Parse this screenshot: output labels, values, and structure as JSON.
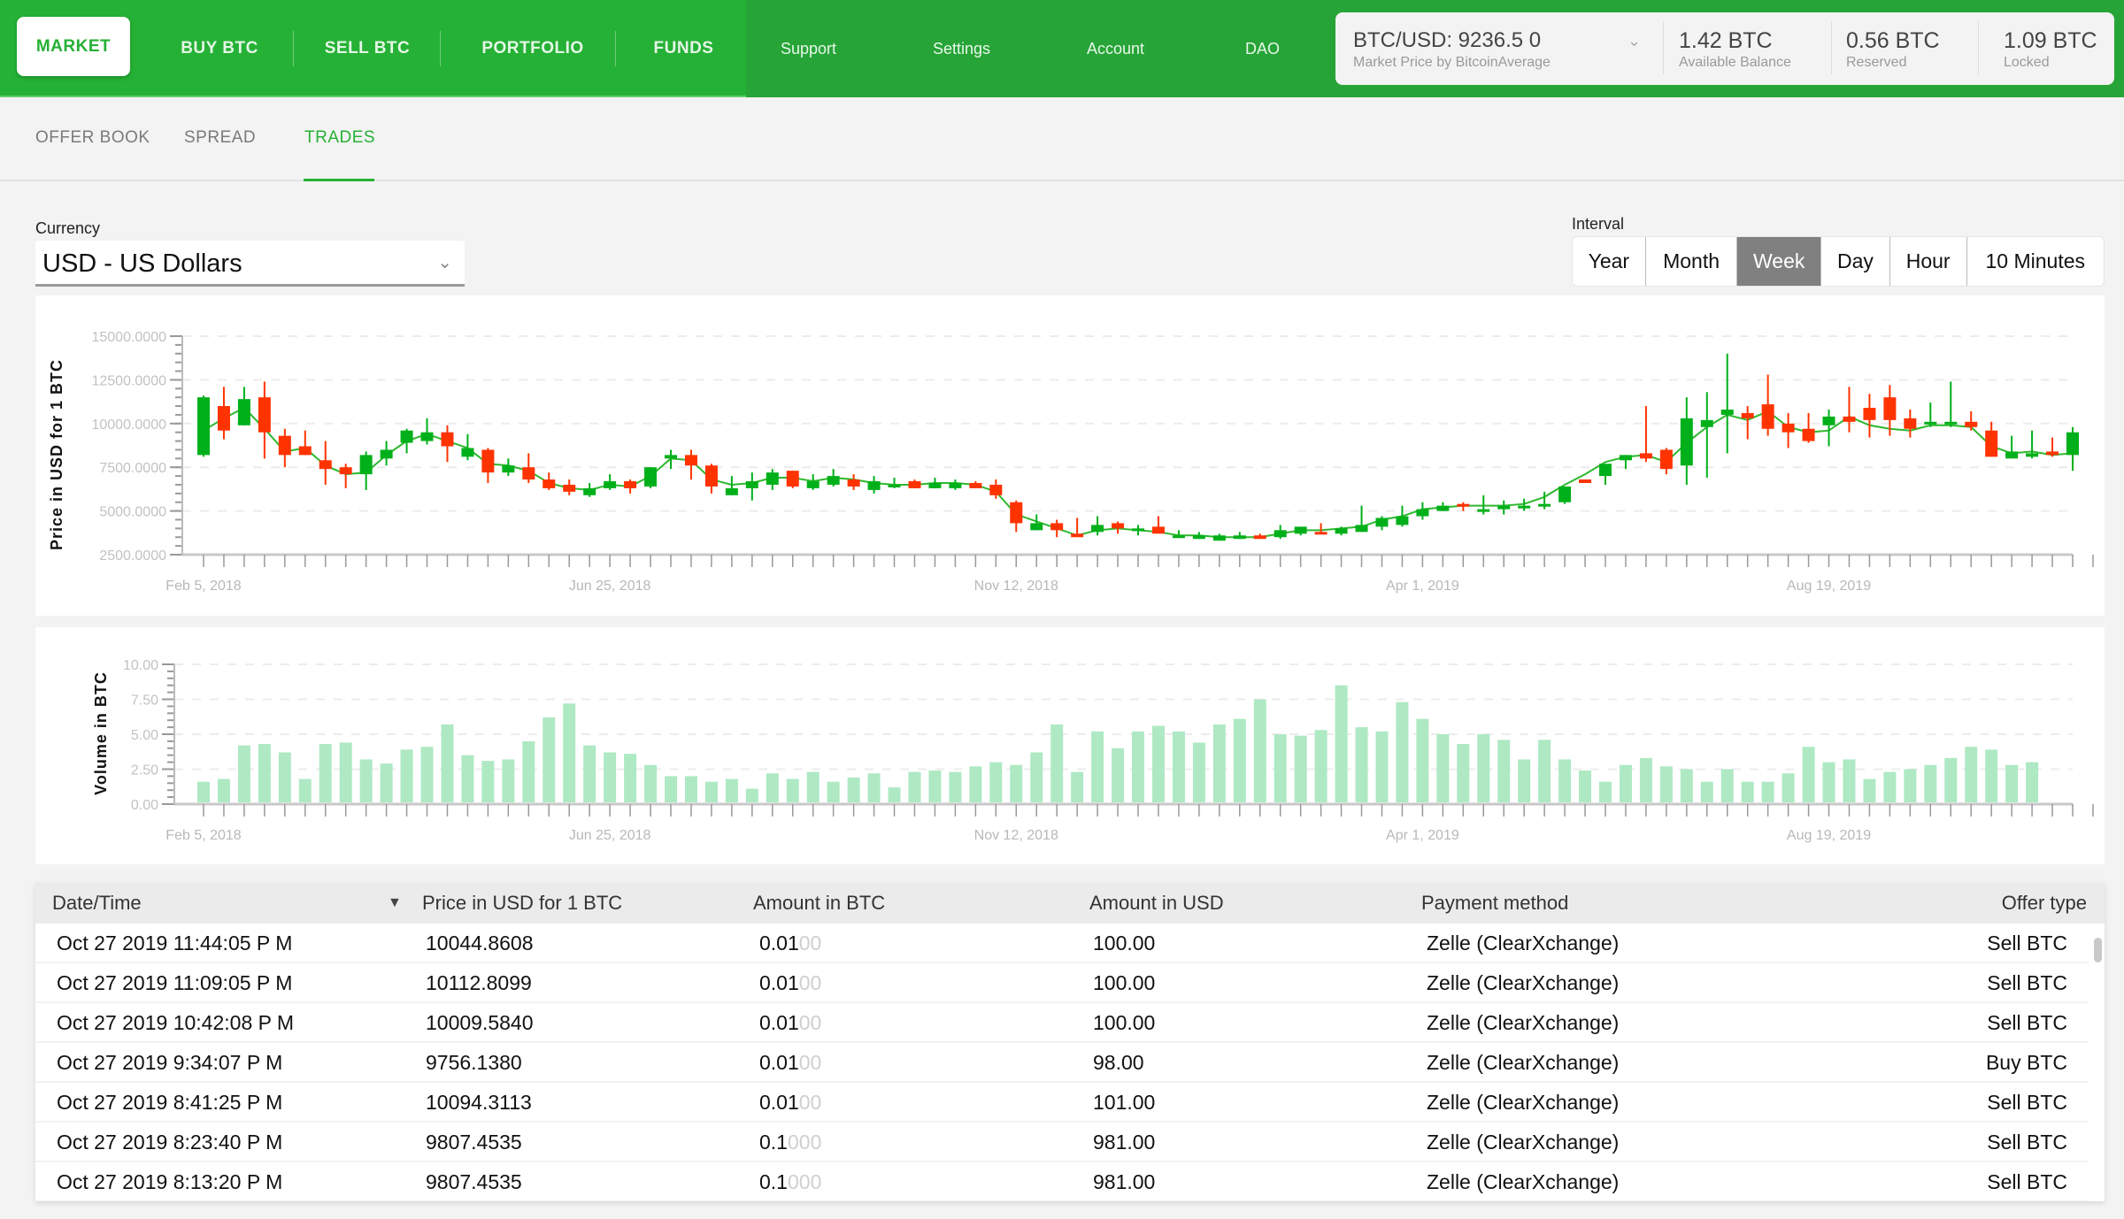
{
  "nav": {
    "primary": [
      {
        "label": "MARKET",
        "active": true
      },
      {
        "label": "BUY BTC",
        "active": false
      },
      {
        "label": "SELL BTC",
        "active": false
      },
      {
        "label": "PORTFOLIO",
        "active": false
      },
      {
        "label": "FUNDS",
        "active": false
      }
    ],
    "secondary": [
      "Support",
      "Settings",
      "Account",
      "DAO"
    ]
  },
  "ticker": {
    "price": "BTC/USD: 9236.5 0",
    "source": "Market Price by BitcoinAverage",
    "balances": [
      {
        "value": "1.42 BTC",
        "label": "Available Balance"
      },
      {
        "value": "0.56 BTC",
        "label": "Reserved"
      },
      {
        "value": "1.09 BTC",
        "label": "Locked"
      }
    ]
  },
  "subtabs": [
    {
      "label": "OFFER BOOK",
      "active": false
    },
    {
      "label": "SPREAD",
      "active": false
    },
    {
      "label": "TRADES",
      "active": true
    }
  ],
  "currency": {
    "label": "Currency",
    "value": "USD - US Dollars"
  },
  "interval": {
    "label": "Interval",
    "options": [
      "Year",
      "Month",
      "Week",
      "Day",
      "Hour",
      "10 Minutes"
    ],
    "selected": "Week"
  },
  "colors": {
    "brand": "#25b135",
    "up": "#00b01a",
    "down": "#ff3300",
    "volume": "#aee9c4",
    "ma_line": "#2eb82e"
  },
  "chart_data": [
    {
      "type": "candlestick",
      "title": "",
      "ylabel": "Price in USD for 1 BTC",
      "xlabel": "",
      "ylim": [
        2500,
        15000
      ],
      "y_ticks": [
        "15000.0000",
        "12500.0000",
        "10000.0000",
        "7500.0000",
        "5000.0000",
        "2500.0000"
      ],
      "x_tick_labels": [
        {
          "label": "Feb 5, 2018",
          "index": 0
        },
        {
          "label": "Jun 25, 2018",
          "index": 20
        },
        {
          "label": "Nov 12, 2018",
          "index": 40
        },
        {
          "label": "Apr 1, 2019",
          "index": 60
        },
        {
          "label": "Aug 19, 2019",
          "index": 80
        }
      ],
      "grid": "horizontal-dashed",
      "x_count": 92,
      "series_name": "BTC weekly OHLC",
      "candles": [
        [
          0,
          8200,
          11600,
          8100,
          11500
        ],
        [
          1,
          11000,
          12100,
          9100,
          9600
        ],
        [
          2,
          9900,
          12100,
          9900,
          11400
        ],
        [
          3,
          11500,
          12400,
          8000,
          9500
        ],
        [
          4,
          9300,
          9700,
          7500,
          8200
        ],
        [
          5,
          8700,
          9600,
          8200,
          8200
        ],
        [
          6,
          7900,
          9000,
          6500,
          7400
        ],
        [
          7,
          7500,
          7700,
          6300,
          7100
        ],
        [
          8,
          7100,
          8400,
          6200,
          8200
        ],
        [
          9,
          8000,
          9000,
          7600,
          8500
        ],
        [
          10,
          8900,
          9700,
          8300,
          9600
        ],
        [
          11,
          9000,
          10300,
          8800,
          9500
        ],
        [
          12,
          9500,
          9900,
          7800,
          8700
        ],
        [
          13,
          8100,
          9400,
          7900,
          8600
        ],
        [
          14,
          8500,
          8600,
          6600,
          7200
        ],
        [
          15,
          7200,
          8000,
          7000,
          7600
        ],
        [
          16,
          7500,
          8300,
          6600,
          6800
        ],
        [
          17,
          6800,
          7200,
          6200,
          6300
        ],
        [
          18,
          6500,
          6800,
          5900,
          6100
        ],
        [
          19,
          5900,
          6600,
          5800,
          6300
        ],
        [
          20,
          6300,
          7100,
          6200,
          6700
        ],
        [
          21,
          6700,
          6800,
          6000,
          6300
        ],
        [
          22,
          6400,
          7500,
          6300,
          7500
        ],
        [
          23,
          8000,
          8500,
          7400,
          8200
        ],
        [
          24,
          8200,
          8500,
          6800,
          7600
        ],
        [
          25,
          7600,
          7700,
          6000,
          6400
        ],
        [
          26,
          5900,
          7000,
          5900,
          6300
        ],
        [
          27,
          6300,
          7200,
          5600,
          6700
        ],
        [
          28,
          6500,
          7400,
          6200,
          7200
        ],
        [
          29,
          7300,
          7300,
          6300,
          6400
        ],
        [
          30,
          6300,
          7100,
          6200,
          6700
        ],
        [
          31,
          6500,
          7400,
          6400,
          7000
        ],
        [
          32,
          6800,
          7100,
          6200,
          6400
        ],
        [
          33,
          6200,
          7000,
          6000,
          6700
        ],
        [
          34,
          6500,
          6900,
          6300,
          6500
        ],
        [
          35,
          6700,
          6800,
          6300,
          6300
        ],
        [
          36,
          6300,
          6900,
          6300,
          6600
        ],
        [
          37,
          6300,
          6800,
          6200,
          6600
        ],
        [
          38,
          6600,
          6700,
          6300,
          6300
        ],
        [
          39,
          6500,
          6800,
          5700,
          5900
        ],
        [
          40,
          5500,
          5600,
          3800,
          4300
        ],
        [
          41,
          3900,
          4800,
          3900,
          4300
        ],
        [
          42,
          4300,
          4500,
          3500,
          3900
        ],
        [
          43,
          3700,
          4600,
          3500,
          3500
        ],
        [
          44,
          3800,
          4700,
          3600,
          4200
        ],
        [
          45,
          4300,
          4400,
          3700,
          4000
        ],
        [
          46,
          3900,
          4200,
          3600,
          4000
        ],
        [
          47,
          4100,
          4700,
          3800,
          3700
        ],
        [
          48,
          3500,
          3900,
          3500,
          3600
        ],
        [
          49,
          3400,
          3800,
          3400,
          3600
        ],
        [
          50,
          3300,
          3700,
          3300,
          3600
        ],
        [
          51,
          3400,
          3800,
          3400,
          3600
        ],
        [
          52,
          3600,
          3700,
          3500,
          3400
        ],
        [
          53,
          3500,
          4200,
          3400,
          3900
        ],
        [
          54,
          3700,
          4000,
          3600,
          4100
        ],
        [
          55,
          3800,
          4300,
          3700,
          3700
        ],
        [
          56,
          3700,
          4100,
          3600,
          4000
        ],
        [
          57,
          3800,
          5300,
          3800,
          4200
        ],
        [
          58,
          4100,
          4700,
          3900,
          4600
        ],
        [
          59,
          4200,
          5300,
          4100,
          4700
        ],
        [
          60,
          4700,
          5500,
          4500,
          5100
        ],
        [
          61,
          5000,
          5500,
          5000,
          5300
        ],
        [
          62,
          5400,
          5500,
          5000,
          5300
        ],
        [
          63,
          5100,
          5900,
          4800,
          5100
        ],
        [
          64,
          5100,
          5600,
          4800,
          5300
        ],
        [
          65,
          5300,
          5700,
          5000,
          5300
        ],
        [
          66,
          5300,
          6100,
          5100,
          5400
        ],
        [
          67,
          5500,
          6200,
          5400,
          6400
        ],
        [
          68,
          6800,
          6800,
          6600,
          6600
        ],
        [
          69,
          7000,
          7500,
          6500,
          7700
        ],
        [
          70,
          7900,
          8200,
          7400,
          8200
        ],
        [
          71,
          8300,
          11000,
          7800,
          8000
        ],
        [
          72,
          8500,
          8600,
          7100,
          7400
        ],
        [
          73,
          7600,
          11500,
          6500,
          10300
        ],
        [
          74,
          9800,
          11800,
          6900,
          10200
        ],
        [
          75,
          10500,
          14000,
          8300,
          10800
        ],
        [
          76,
          10600,
          11000,
          9100,
          10300
        ],
        [
          77,
          11100,
          12800,
          9300,
          9700
        ],
        [
          78,
          10000,
          10600,
          8600,
          9500
        ],
        [
          79,
          9700,
          10600,
          8900,
          9000
        ],
        [
          80,
          9900,
          10800,
          8700,
          10400
        ],
        [
          81,
          10400,
          12100,
          9500,
          10100
        ],
        [
          82,
          10900,
          11700,
          9200,
          10200
        ],
        [
          83,
          11500,
          12200,
          9300,
          10200
        ],
        [
          84,
          10300,
          10800,
          9200,
          9700
        ],
        [
          85,
          10100,
          11200,
          9800,
          10100
        ],
        [
          86,
          10000,
          12400,
          9800,
          10100
        ],
        [
          87,
          10100,
          10700,
          9600,
          9800
        ],
        [
          88,
          9600,
          10100,
          8100,
          8100
        ],
        [
          89,
          8000,
          9300,
          8200,
          8400
        ],
        [
          90,
          8100,
          9600,
          8000,
          8300
        ],
        [
          91,
          8400,
          9200,
          8100,
          8200
        ],
        [
          92,
          8200,
          9800,
          7300,
          9500
        ]
      ],
      "moving_average": [
        9600,
        10300,
        10900,
        9700,
        8400,
        8600,
        7600,
        7100,
        7200,
        8200,
        9000,
        9400,
        9000,
        8600,
        7700,
        7600,
        7300,
        6600,
        6300,
        6200,
        6500,
        6400,
        7000,
        8000,
        7900,
        6800,
        6500,
        6600,
        6900,
        6900,
        6700,
        6900,
        6800,
        6600,
        6500,
        6500,
        6600,
        6600,
        6500,
        6100,
        4800,
        4400,
        4000,
        3600,
        3900,
        4000,
        3900,
        3800,
        3600,
        3600,
        3500,
        3500,
        3500,
        3700,
        3900,
        3900,
        4000,
        4100,
        4500,
        4700,
        5100,
        5200,
        5300,
        5300,
        5300,
        5400,
        5800,
        6500,
        7100,
        7800,
        8100,
        8200,
        7800,
        8900,
        9800,
        10500,
        10200,
        10700,
        9800,
        9500,
        9600,
        10400,
        9900,
        9700,
        9600,
        9900,
        9900,
        9800,
        8700,
        8300,
        8400,
        8200,
        8300
      ]
    },
    {
      "type": "bar",
      "title": "",
      "ylabel": "Volume in BTC",
      "xlabel": "",
      "ylim": [
        0,
        10
      ],
      "y_ticks": [
        "10.00",
        "7.50",
        "5.00",
        "2.50",
        "0.00"
      ],
      "x_tick_labels": [
        {
          "label": "Feb 5, 2018",
          "index": 0
        },
        {
          "label": "Jun 25, 2018",
          "index": 20
        },
        {
          "label": "Nov 12, 2018",
          "index": 40
        },
        {
          "label": "Apr 1, 2019",
          "index": 60
        },
        {
          "label": "Aug 19, 2019",
          "index": 80
        }
      ],
      "grid": "horizontal-dashed",
      "x_count": 92,
      "values": [
        1.6,
        1.8,
        4.2,
        4.3,
        3.7,
        1.8,
        4.3,
        4.4,
        3.2,
        2.9,
        3.9,
        4.1,
        5.7,
        3.5,
        3.1,
        3.2,
        4.5,
        6.2,
        7.2,
        4.2,
        3.7,
        3.6,
        2.8,
        2.0,
        2.0,
        1.6,
        1.8,
        1.1,
        2.2,
        1.8,
        2.3,
        1.6,
        1.9,
        2.2,
        1.2,
        2.3,
        2.4,
        2.3,
        2.7,
        3.0,
        2.8,
        3.7,
        5.7,
        2.3,
        5.2,
        4.0,
        5.2,
        5.6,
        5.2,
        4.4,
        5.7,
        6.1,
        7.5,
        5.0,
        4.9,
        5.3,
        8.5,
        5.5,
        5.2,
        7.3,
        6.1,
        5.0,
        4.3,
        5.0,
        4.6,
        3.2,
        4.6,
        3.2,
        2.4,
        1.6,
        2.8,
        3.3,
        2.7,
        2.5,
        1.6,
        2.5,
        1.6,
        1.6,
        2.2,
        4.1,
        3.0,
        3.2,
        1.8,
        2.3,
        2.5,
        2.8,
        3.3,
        4.1,
        3.9,
        2.8,
        3.0
      ],
      "color": "#aee9c4"
    }
  ],
  "table": {
    "sort_icon": "sort-desc-icon",
    "columns": [
      "Date/Time",
      "Price in USD for 1 BTC",
      "Amount in BTC",
      "Amount in USD",
      "Payment method",
      "Offer type"
    ],
    "rows": [
      {
        "date": "Oct 27 2019 11:44:05 P M",
        "price": "10044.8608",
        "amount_btc": "0.01",
        "amount_btc_pad": "00",
        "amount_usd": "100.00",
        "method": "Zelle (ClearXchange)",
        "type": "Sell BTC"
      },
      {
        "date": "Oct 27 2019 11:09:05 P M",
        "price": "10112.8099",
        "amount_btc": "0.01",
        "amount_btc_pad": "00",
        "amount_usd": "100.00",
        "method": "Zelle (ClearXchange)",
        "type": "Sell BTC"
      },
      {
        "date": "Oct 27 2019 10:42:08 P M",
        "price": "10009.5840",
        "amount_btc": "0.01",
        "amount_btc_pad": "00",
        "amount_usd": "100.00",
        "method": "Zelle (ClearXchange)",
        "type": "Sell BTC"
      },
      {
        "date": "Oct 27 2019 9:34:07 P M",
        "price": "9756.1380",
        "amount_btc": "0.01",
        "amount_btc_pad": "00",
        "amount_usd": "98.00",
        "method": "Zelle (ClearXchange)",
        "type": "Buy BTC"
      },
      {
        "date": "Oct 27 2019 8:41:25 P M",
        "price": "10094.3113",
        "amount_btc": "0.01",
        "amount_btc_pad": "00",
        "amount_usd": "101.00",
        "method": "Zelle (ClearXchange)",
        "type": "Sell BTC"
      },
      {
        "date": "Oct 27 2019 8:23:40 P M",
        "price": "9807.4535",
        "amount_btc": "0.1",
        "amount_btc_pad": "000",
        "amount_usd": "981.00",
        "method": "Zelle (ClearXchange)",
        "type": "Sell BTC"
      },
      {
        "date": "Oct 27 2019 8:13:20 P M",
        "price": "9807.4535",
        "amount_btc": "0.1",
        "amount_btc_pad": "000",
        "amount_usd": "981.00",
        "method": "Zelle (ClearXchange)",
        "type": "Sell BTC"
      }
    ]
  }
}
